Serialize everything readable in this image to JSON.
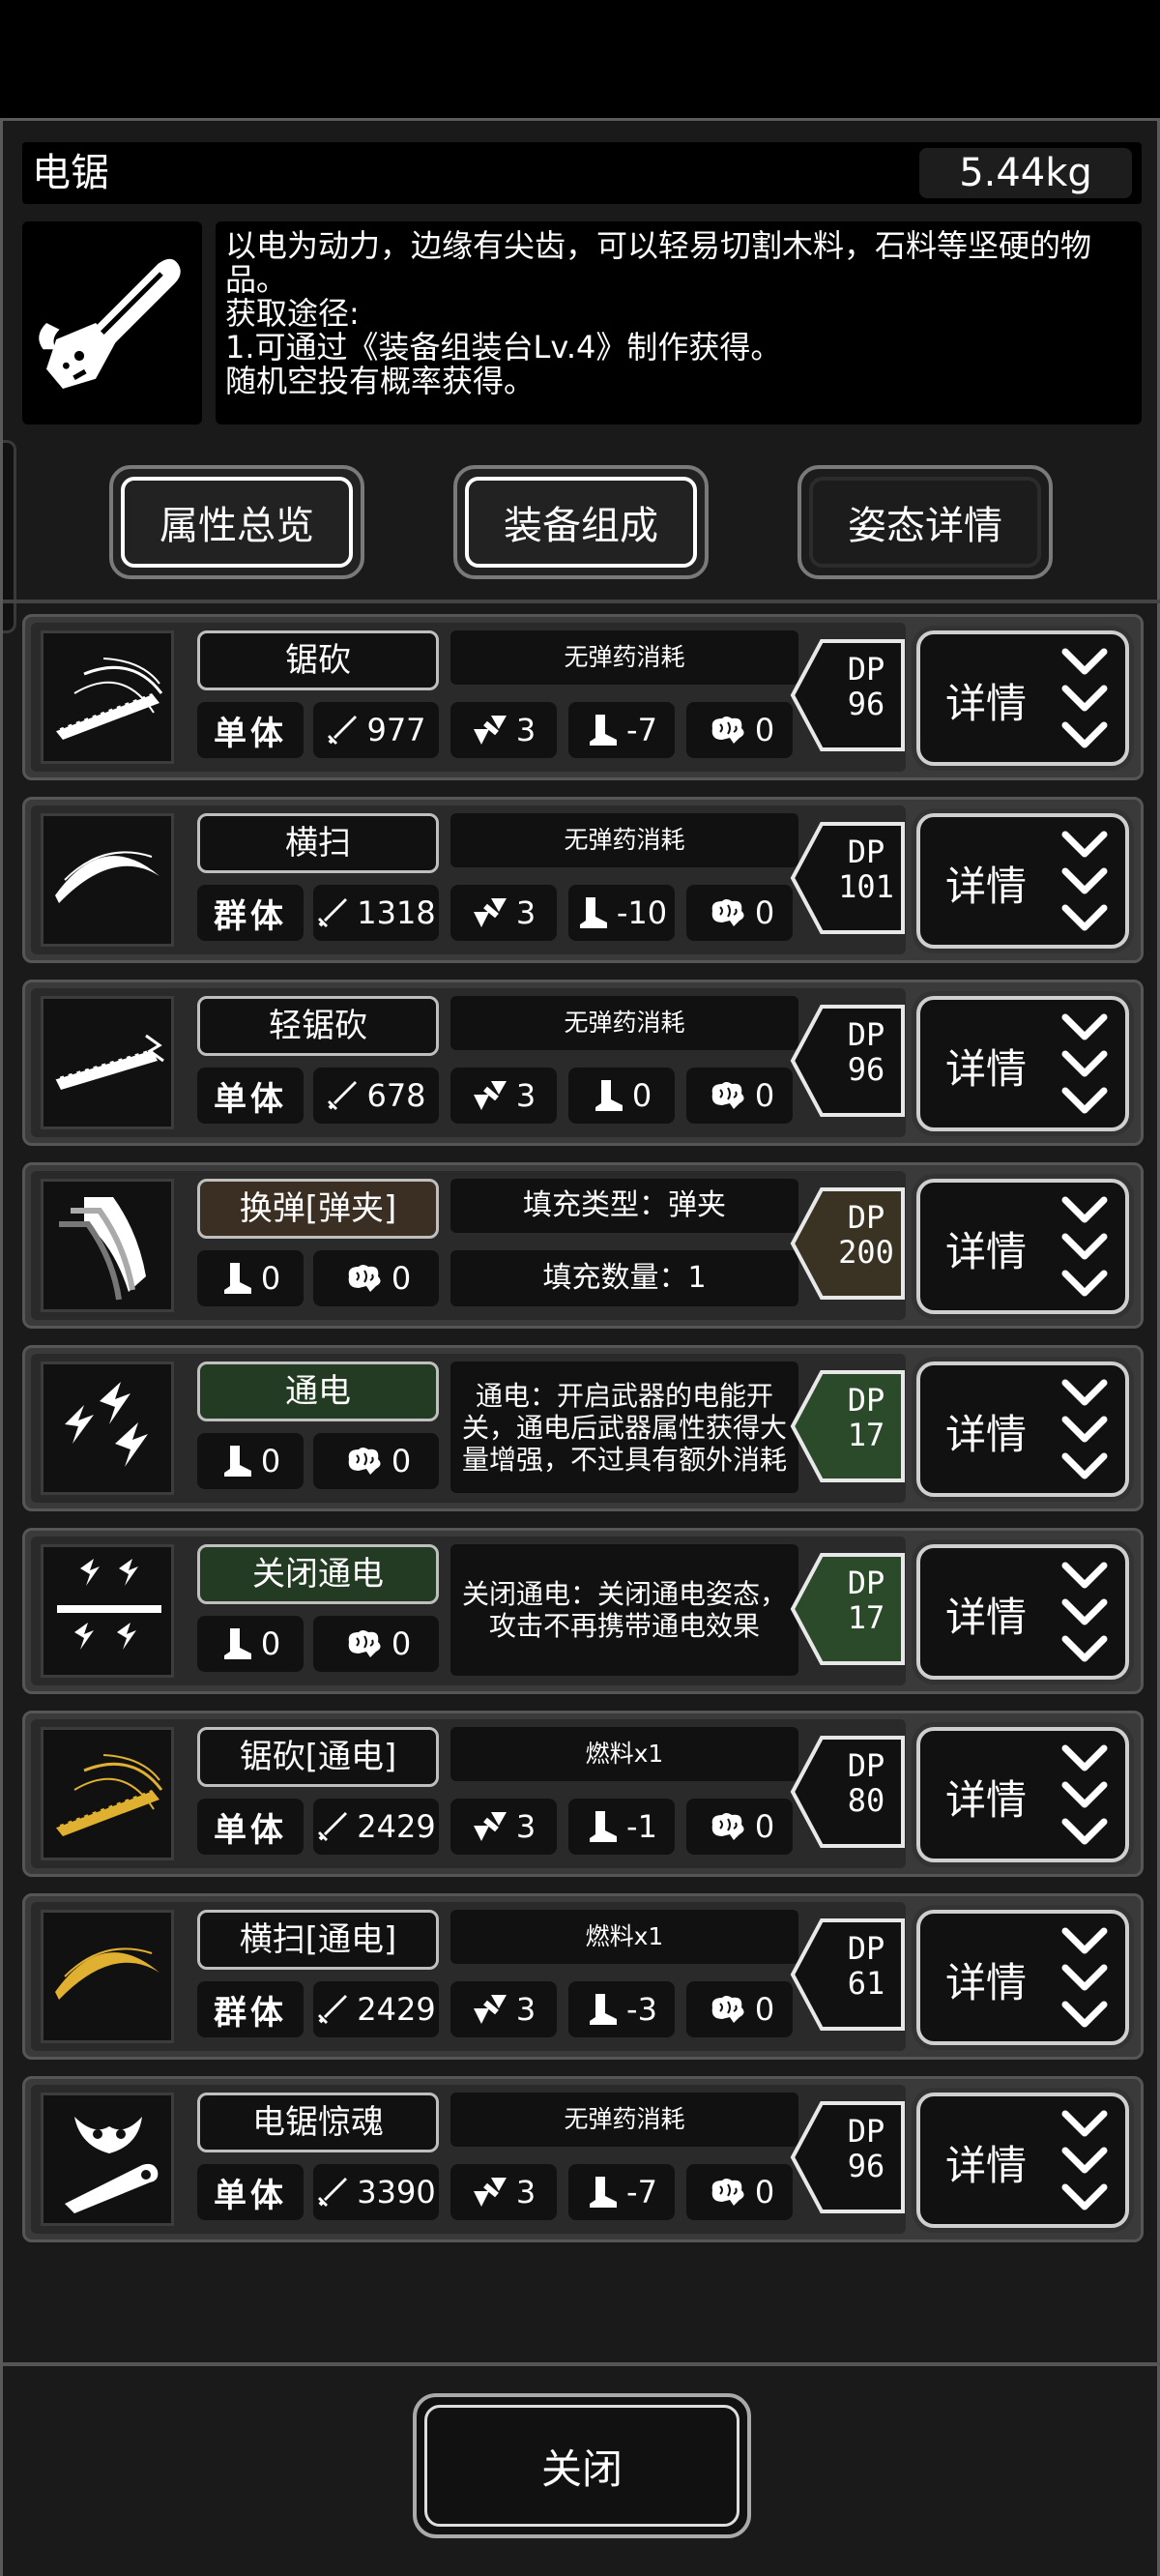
{
  "item": {
    "title": "电锯",
    "weight": "5.44kg",
    "icon": "chainsaw-icon",
    "description": [
      "以电为动力，边缘有尖齿，可以轻易切割木料，石料等坚硬的物品。",
      "获取途径:",
      "1.可通过《装备组装台Lv.4》制作获得。",
      "随机空投有概率获得。"
    ]
  },
  "tabs": {
    "overview": "属性总览",
    "composition": "装备组成",
    "stance": "姿态详情",
    "selected": "stance"
  },
  "skills": [
    {
      "name": "锯砍",
      "style": "default",
      "cost": "无弹药消耗",
      "target": "单体",
      "attack": "977",
      "hit": "3",
      "move": "-7",
      "brain": "0",
      "dp": "96",
      "dp_color": "#111111",
      "detail": "详情",
      "icon": "chainsaw-slash-icon"
    },
    {
      "name": "横扫",
      "style": "default",
      "cost": "无弹药消耗",
      "target": "群体",
      "attack": "1318",
      "hit": "3",
      "move": "-10",
      "brain": "0",
      "dp": "101",
      "dp_color": "#111111",
      "detail": "详情",
      "icon": "sweep-slash-icon"
    },
    {
      "name": "轻锯砍",
      "style": "default",
      "cost": "无弹药消耗",
      "target": "单体",
      "attack": "678",
      "hit": "3",
      "move": "0",
      "brain": "0",
      "dp": "96",
      "dp_color": "#111111",
      "detail": "详情",
      "icon": "light-chainsaw-icon"
    },
    {
      "name": "换弹[弹夹]",
      "style": "brown",
      "fill_type": "填充类型：弹夹",
      "fill_count": "填充数量：1",
      "move": "0",
      "brain": "0",
      "dp": "200",
      "dp_color": "#3a3222",
      "detail": "详情",
      "icon": "magazine-reload-icon"
    },
    {
      "name": "通电",
      "style": "green",
      "note": "通电：开启武器的电能开关，通电后武器属性获得大量增强，不过具有额外消耗",
      "move": "0",
      "brain": "0",
      "dp": "17",
      "dp_color": "#2a4a2a",
      "detail": "详情",
      "icon": "electric-bolts-icon"
    },
    {
      "name": "关闭通电",
      "style": "green",
      "note": "关闭通电：关闭通电姿态，攻击不再携带通电效果",
      "move": "0",
      "brain": "0",
      "dp": "17",
      "dp_color": "#2a4a2a",
      "detail": "详情",
      "icon": "power-off-bolts-icon"
    },
    {
      "name": "锯砍[通电]",
      "style": "default",
      "cost": "燃料x1",
      "target": "单体",
      "attack": "2429",
      "hit": "3",
      "move": "-1",
      "brain": "0",
      "dp": "80",
      "dp_color": "#111111",
      "detail": "详情",
      "icon": "electric-chainsaw-slash-icon"
    },
    {
      "name": "横扫[通电]",
      "style": "default",
      "cost": "燃料x1",
      "target": "群体",
      "attack": "2429",
      "hit": "3",
      "move": "-3",
      "brain": "0",
      "dp": "61",
      "dp_color": "#111111",
      "detail": "详情",
      "icon": "electric-sweep-icon"
    },
    {
      "name": "电锯惊魂",
      "style": "default",
      "cost": "无弹药消耗",
      "target": "单体",
      "attack": "3390",
      "hit": "3",
      "move": "-7",
      "brain": "0",
      "dp": "96",
      "dp_color": "#111111",
      "detail": "详情",
      "icon": "chainsaw-massacre-icon"
    }
  ],
  "close": "关闭"
}
